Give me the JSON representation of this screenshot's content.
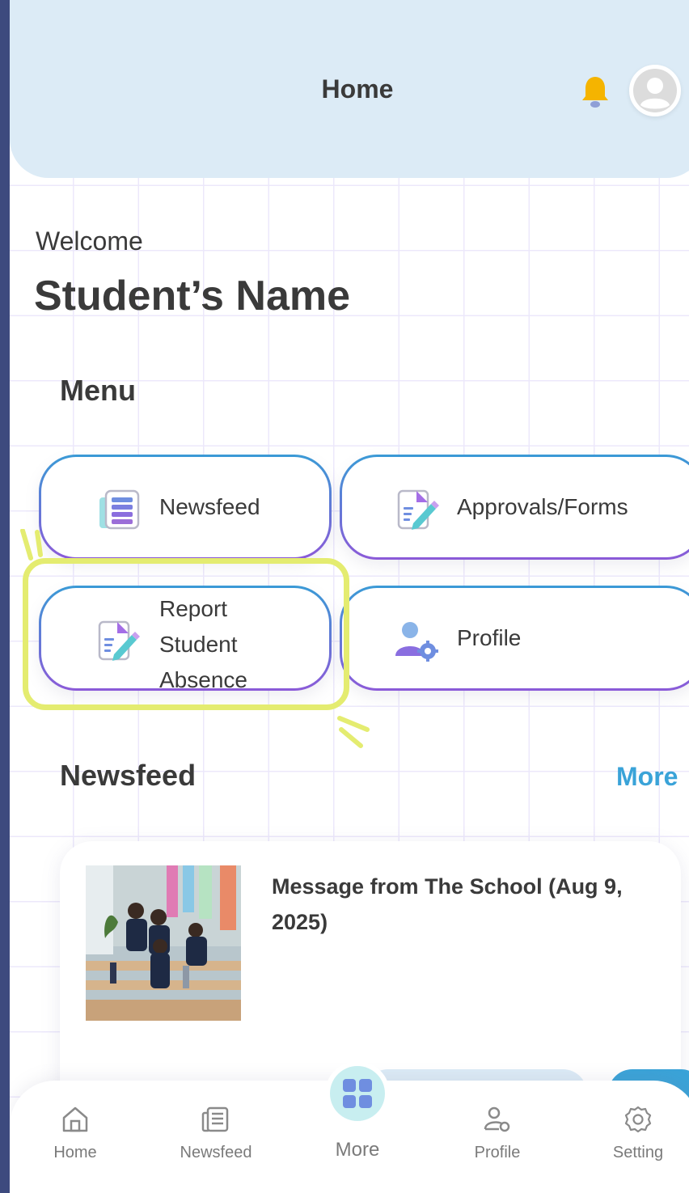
{
  "header": {
    "title": "Home"
  },
  "welcome": "Welcome",
  "student_name": "Student’s Name",
  "menu": {
    "title": "Menu",
    "items": [
      {
        "label": "Newsfeed",
        "icon": "newsfeed-icon"
      },
      {
        "label": "Approvals/Forms",
        "icon": "form-edit-icon"
      },
      {
        "label_lines": [
          "Report",
          "Student",
          "Absence"
        ],
        "icon": "form-edit-icon",
        "highlighted": true
      },
      {
        "label": "Profile",
        "icon": "profile-settings-icon"
      }
    ]
  },
  "newsfeed": {
    "title": "Newsfeed",
    "more": "More",
    "items": [
      {
        "title": "Message from The School (Aug 9, 2025)",
        "image": "students-photo"
      }
    ]
  },
  "tabbar": {
    "items": [
      {
        "label": "Home",
        "icon": "home-icon"
      },
      {
        "label": "Newsfeed",
        "icon": "newsfeed-icon"
      },
      {
        "label": "More",
        "icon": "grid-icon",
        "active": true
      },
      {
        "label": "Profile",
        "icon": "profile-settings-icon"
      },
      {
        "label": "Setting",
        "icon": "gear-icon"
      }
    ]
  },
  "colors": {
    "frame": "#3d4a7e",
    "header_bg": "#dcebf6",
    "accent_blue": "#3aa3d8",
    "accent_purple": "#8b5ad8",
    "highlight": "#e4ec70",
    "bell": "#f5b400",
    "text": "#3a3a3a"
  }
}
